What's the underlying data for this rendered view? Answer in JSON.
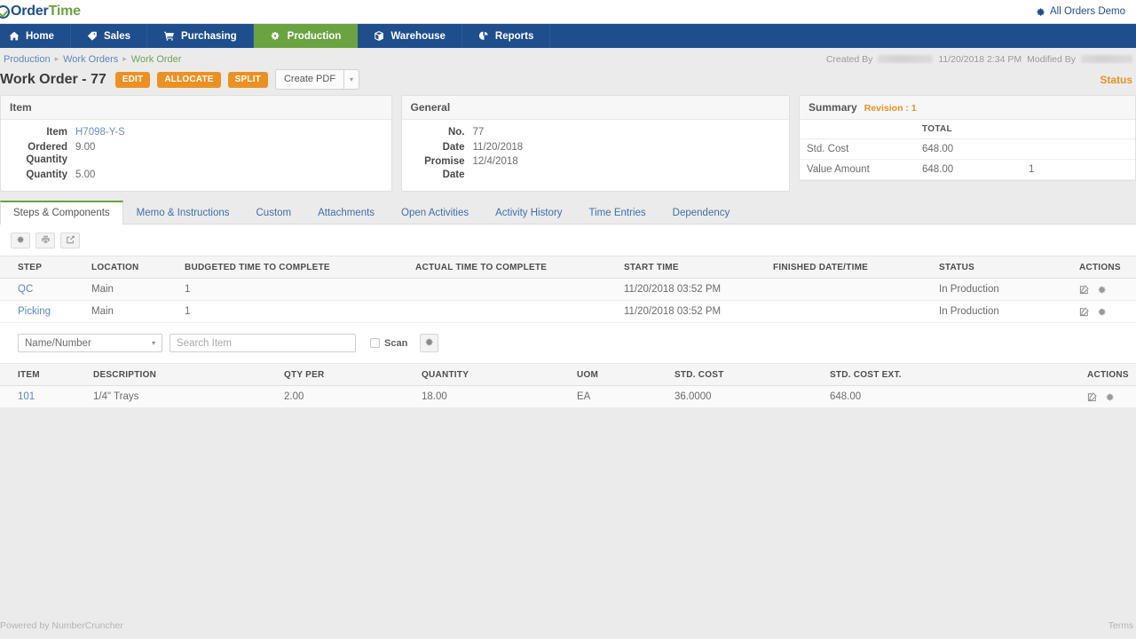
{
  "topbar": {
    "logo_order": "Order",
    "logo_time": "Time",
    "account_label": "All Orders Demo",
    "gear_icon": "gear-icon"
  },
  "mainnav": [
    {
      "label": "Home",
      "icon": "home-icon",
      "active": false
    },
    {
      "label": "Sales",
      "icon": "tag-icon",
      "active": false
    },
    {
      "label": "Purchasing",
      "icon": "cart-icon",
      "active": false
    },
    {
      "label": "Production",
      "icon": "cogs-icon",
      "active": true
    },
    {
      "label": "Warehouse",
      "icon": "box-icon",
      "active": false
    },
    {
      "label": "Reports",
      "icon": "pie-chart-icon",
      "active": false
    }
  ],
  "breadcrumb": {
    "items": [
      "Production",
      "Work Orders",
      "Work Order"
    ],
    "separator": "▸"
  },
  "audit": {
    "created_by_label": "Created By",
    "created_by_value": "",
    "created_date": "11/20/2018 2:34 PM",
    "modified_by_label": "Modified By",
    "modified_by_value": ""
  },
  "title": {
    "text": "Work Order - 77",
    "buttons": [
      {
        "label": "EDIT",
        "style": "orange"
      },
      {
        "label": "ALLOCATE",
        "style": "orange"
      },
      {
        "label": "SPLIT",
        "style": "orange"
      }
    ],
    "split_button": {
      "label": "Create PDF",
      "caret": "▾"
    },
    "status_link": "Status"
  },
  "panels": {
    "item": {
      "heading": "Item",
      "rows": [
        {
          "label": "Item",
          "value": "H7098-Y-S",
          "link": true
        },
        {
          "label": "Ordered Quantity",
          "value": "9.00",
          "link": false
        },
        {
          "label": "Quantity",
          "value": "5.00",
          "link": false
        }
      ]
    },
    "general": {
      "heading": "General",
      "rows": [
        {
          "label": "No.",
          "value": "77"
        },
        {
          "label": "Date",
          "value": "11/20/2018"
        },
        {
          "label": "Promise Date",
          "value": "12/4/2018"
        }
      ]
    },
    "summary": {
      "heading": "Summary",
      "revision": "Revision : 1",
      "columns": [
        "",
        "TOTAL",
        ""
      ],
      "rows": [
        {
          "label": "Std. Cost",
          "total": "648.00",
          "extra": ""
        },
        {
          "label": "Value Amount",
          "total": "648.00",
          "extra": "1"
        }
      ]
    }
  },
  "tabs": [
    {
      "label": "Steps & Components",
      "active": true
    },
    {
      "label": "Memo & Instructions",
      "active": false
    },
    {
      "label": "Custom",
      "active": false
    },
    {
      "label": "Attachments",
      "active": false
    },
    {
      "label": "Open Activities",
      "active": false
    },
    {
      "label": "Activity History",
      "active": false
    },
    {
      "label": "Time Entries",
      "active": false
    },
    {
      "label": "Dependency",
      "active": false
    }
  ],
  "toolbar": {
    "buttons": [
      {
        "icon": "gear-icon",
        "name": "settings-button"
      },
      {
        "icon": "printer-icon",
        "name": "print-button"
      },
      {
        "icon": "export-icon",
        "name": "export-button"
      }
    ]
  },
  "steps_table": {
    "columns": [
      "STEP",
      "LOCATION",
      "BUDGETED TIME TO COMPLETE",
      "ACTUAL TIME TO COMPLETE",
      "START TIME",
      "FINISHED DATE/TIME",
      "STATUS",
      "ACTIONS"
    ],
    "rows": [
      {
        "step": "QC",
        "location": "Main",
        "budgeted": "1",
        "actual": "",
        "start_time": "11/20/2018 03:52 PM",
        "finished": "",
        "status": "In Production"
      },
      {
        "step": "Picking",
        "location": "Main",
        "budgeted": "1",
        "actual": "",
        "start_time": "11/20/2018 03:52 PM",
        "finished": "",
        "status": "In Production"
      }
    ]
  },
  "filter": {
    "select_value": "Name/Number",
    "select_caret": "▾",
    "search_placeholder": "Search Item",
    "search_value": "",
    "scan_label": "Scan",
    "scan_checked": false,
    "gear_icon": "gear-icon"
  },
  "components_table": {
    "columns": [
      "ITEM",
      "DESCRIPTION",
      "QTY PER",
      "QUANTITY",
      "UOM",
      "STD. COST",
      "STD. COST EXT.",
      "ACTIONS"
    ],
    "rows": [
      {
        "item": "101",
        "description": "1/4\" Trays",
        "qty_per": "2.00",
        "quantity": "18.00",
        "uom": "EA",
        "std_cost": "36.0000",
        "std_cost_ext": "648.00"
      }
    ]
  },
  "footer": {
    "powered_by": "Powered by NumberCruncher",
    "terms": "Terms o"
  },
  "colors": {
    "nav_blue": "#1f4e8c",
    "accent_green": "#6aa342",
    "accent_orange": "#eb9124",
    "link_blue": "#5b87bf",
    "page_bg": "#ebebeb"
  }
}
